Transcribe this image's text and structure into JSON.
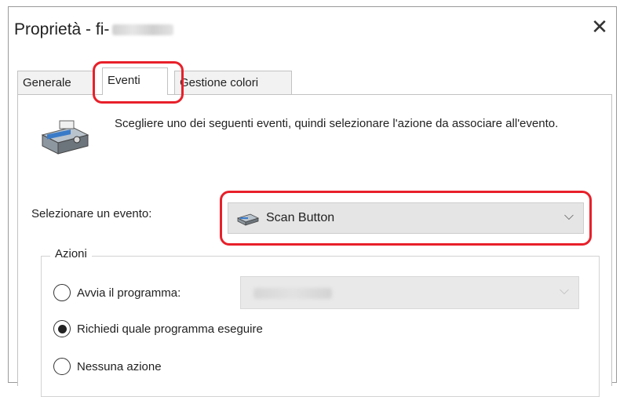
{
  "window": {
    "title": "Proprietà - fi-",
    "close_glyph": "✕"
  },
  "tabs": [
    {
      "label": "Generale",
      "active": false
    },
    {
      "label": "Eventi",
      "active": true
    },
    {
      "label": "Gestione colori",
      "active": false
    }
  ],
  "events_tab": {
    "description": "Scegliere uno dei seguenti eventi, quindi selezionare l'azione da associare all'evento.",
    "icon": "scanner-icon",
    "select_label": "Selezionare un evento:",
    "selected_event": "Scan Button",
    "selected_event_icon": "scanner-small-icon",
    "chevron": "⌵"
  },
  "actions": {
    "title": "Azioni",
    "options": [
      {
        "label": "Avvia il programma:",
        "selected": false
      },
      {
        "label": "Richiedi quale programma eseguire",
        "selected": true
      },
      {
        "label": "Nessuna azione",
        "selected": false
      }
    ],
    "program_chevron": "⌵"
  },
  "colors": {
    "highlight": "#e8202a",
    "panel_border": "#c2c2c2"
  }
}
